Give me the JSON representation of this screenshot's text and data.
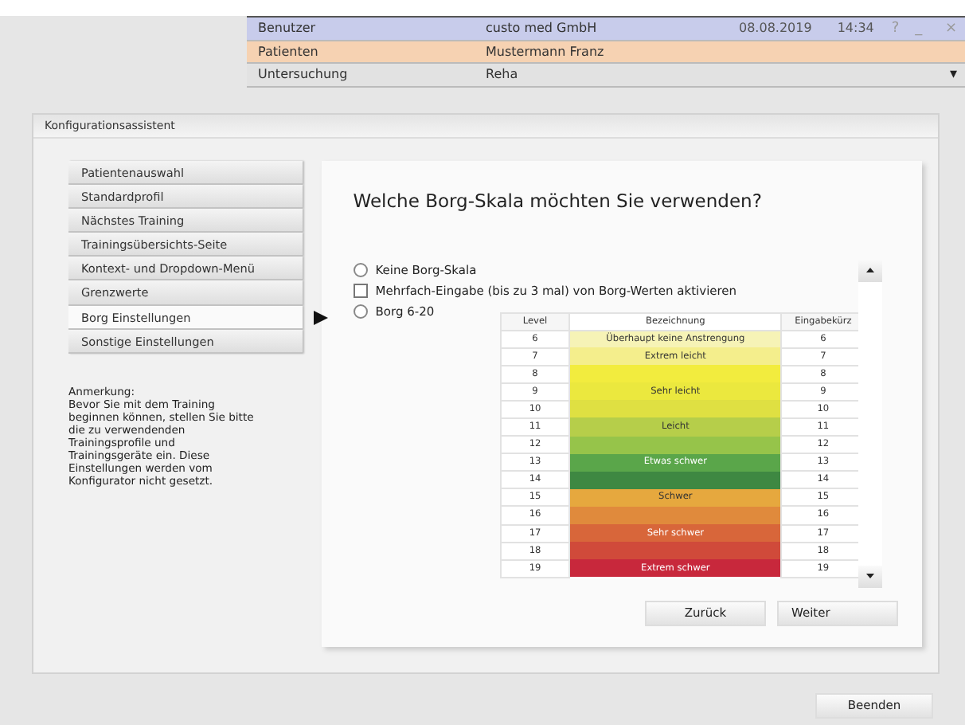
{
  "header": {
    "rows": [
      {
        "label": "Benutzer",
        "value": "custo med GmbH",
        "kind": "user",
        "date": "08.08.2019",
        "time": "14:34",
        "help": "?",
        "minimize": "_",
        "close": "×"
      },
      {
        "label": "Patienten",
        "value": "Mustermann Franz",
        "kind": "patient"
      },
      {
        "label": "Untersuchung",
        "value": "Reha",
        "kind": "exam",
        "dropdown": "▾"
      }
    ]
  },
  "dialog": {
    "title": "Konfigurationsassistent",
    "menu": [
      {
        "label": "Patientenauswahl",
        "selected": false
      },
      {
        "label": "Standardprofil",
        "selected": false
      },
      {
        "label": "Nächstes Training",
        "selected": false
      },
      {
        "label": "Trainingsübersichts-Seite",
        "selected": false
      },
      {
        "label": "Kontext- und Dropdown-Menü",
        "selected": false
      },
      {
        "label": "Grenzwerte",
        "selected": false
      },
      {
        "label": "Borg Einstellungen",
        "selected": true
      },
      {
        "label": "Sonstige Einstellungen",
        "selected": false
      }
    ],
    "note": {
      "heading": "Anmerkung:",
      "text": "Bevor Sie mit dem Training beginnen können, stellen Sie bitte die zu verwendenden Trainingsprofile und Trainingsgeräte ein. Diese Einstellungen werden vom Konfigurator nicht gesetzt."
    },
    "question": "Welche Borg-Skala möchten Sie verwenden?",
    "options": [
      {
        "kind": "radio",
        "label": "Keine Borg-Skala",
        "selected": false
      },
      {
        "kind": "checkbox",
        "label": "Mehrfach-Eingabe (bis zu 3 mal) von Borg-Werten aktivieren",
        "checked": false
      },
      {
        "kind": "radio",
        "label": "Borg 6-20",
        "selected": false
      }
    ],
    "table": {
      "columns": [
        "Level",
        "Bezeichnung",
        "Eingabekürz"
      ],
      "rows": [
        {
          "level": "6",
          "label": "Überhaupt keine Anstrengung",
          "input": "6",
          "color": "#f6f3b6"
        },
        {
          "level": "7",
          "label": "Extrem leicht",
          "input": "7",
          "color": "#f4ee8c"
        },
        {
          "level": "8",
          "input": "8",
          "color": "#f2ec3e"
        },
        {
          "level": "9",
          "label": "Sehr leicht",
          "input": "9",
          "color": "#ebe83e"
        },
        {
          "level": "10",
          "input": "10",
          "color": "#dfe042"
        },
        {
          "level": "11",
          "label": "Leicht",
          "input": "11",
          "color": "#b6ce4a"
        },
        {
          "level": "12",
          "input": "12",
          "color": "#96c44a"
        },
        {
          "level": "13",
          "label": "Etwas schwer",
          "input": "13",
          "color": "#5aa64a"
        },
        {
          "level": "14",
          "input": "14",
          "color": "#3e8842"
        },
        {
          "level": "15",
          "label": "Schwer",
          "input": "15",
          "color": "#e6a83e"
        },
        {
          "level": "16",
          "input": "16",
          "color": "#e08a3c"
        },
        {
          "level": "17",
          "label": "Sehr schwer",
          "input": "17",
          "color": "#d8663a"
        },
        {
          "level": "18",
          "input": "18",
          "color": "#d04a3a"
        },
        {
          "level": "19",
          "label": "Extrem schwer",
          "input": "19",
          "color": "#c8283c"
        }
      ]
    },
    "nav_buttons": [
      "Zurück",
      "Weiter"
    ],
    "close_button": "Beenden"
  }
}
